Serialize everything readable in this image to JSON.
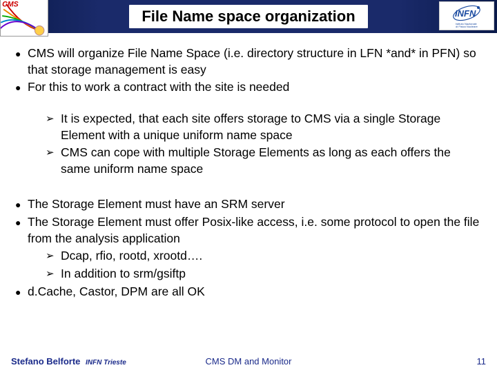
{
  "header": {
    "title": "File Name space organization"
  },
  "bullets": {
    "b1": "CMS will organize File Name Space (i.e. directory structure in LFN *and* in PFN) so that storage management is easy",
    "b2": "For this to work a contract with the site is needed",
    "sub1": {
      "s1": "It is expected, that each site offers storage to CMS via a single Storage Element with a unique uniform name space",
      "s2": "CMS can cope with multiple Storage Elements as long as each offers the same uniform name space"
    },
    "b3": "The Storage Element must have an SRM server",
    "b4": "The Storage Element must offer Posix-like access, i.e. some protocol to open the file from the analysis application",
    "sub2": {
      "s1": "Dcap, rfio, rootd, xrootd….",
      "s2": "In addition to srm/gsiftp"
    },
    "b5": "d.Cache, Castor, DPM are all OK"
  },
  "footer": {
    "author": "Stefano Belforte",
    "institution": "INFN Trieste",
    "center": "CMS DM and Monitor",
    "page": "11"
  },
  "logos": {
    "left": "cms-logo",
    "right": "infn-logo"
  }
}
